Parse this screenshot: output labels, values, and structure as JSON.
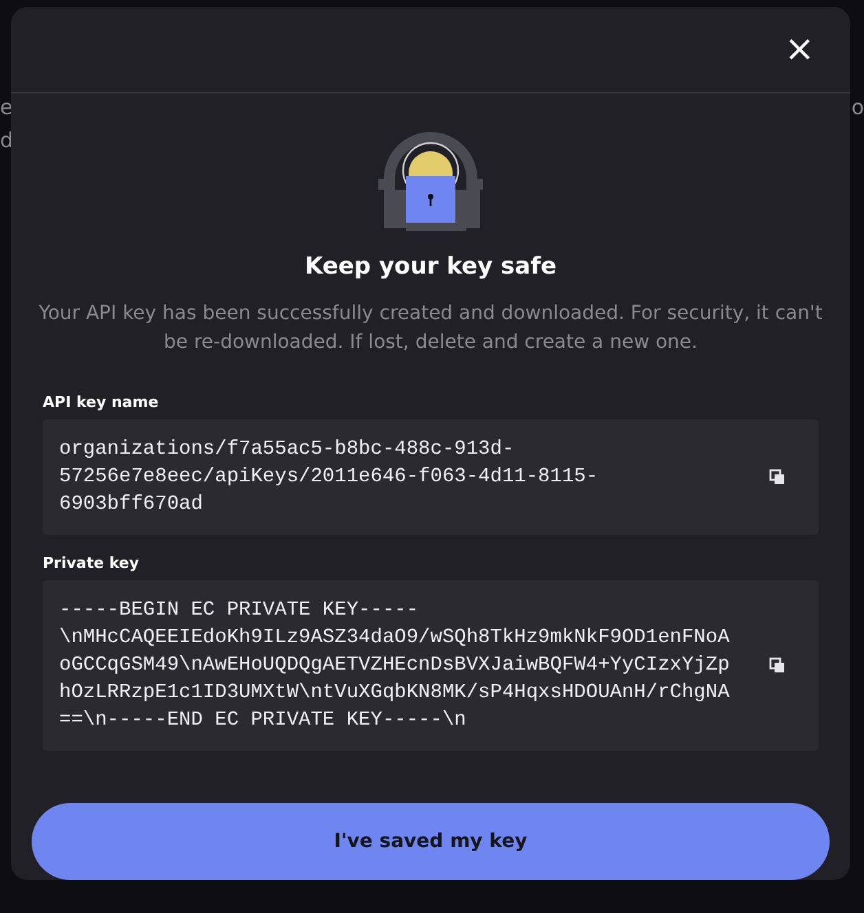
{
  "background_fragments": {
    "left": [
      "e",
      "d"
    ],
    "right": [
      "o"
    ]
  },
  "dialog": {
    "close_label": "×",
    "title": "Keep your key safe",
    "description": "Your API key has been successfully created and downloaded. For security, it can't be re-downloaded. If lost, delete and create a new one.",
    "fields": [
      {
        "label": "API key name",
        "lines": [
          "organizations/f7a55ac5-b8bc-488c-913d-",
          "57256e7e8eec/apiKeys/2011e646-f063-4d11-8115-",
          "6903bff670ad"
        ]
      },
      {
        "label": "Private key",
        "lines": [
          "-----BEGIN EC PRIVATE KEY-----",
          "\\nMHcCAQEEIEdoKh9ILz9ASZ34daO9/wSQh8TkHz9mkNkF9OD1enFNoA",
          "oGCCqGSM49\\nAwEHoUQDQgAETVZHEcnDsBVXJaiwBQFW4+YyCIzxYjZp",
          "hOzLRRzpE1c1ID3UMXtW\\ntVuXGqbKN8MK/sP4HqxsHDOUAnH/rChgNA",
          "==\\n-----END EC PRIVATE KEY-----\\n"
        ]
      }
    ],
    "confirm_button": "I've saved my key"
  }
}
